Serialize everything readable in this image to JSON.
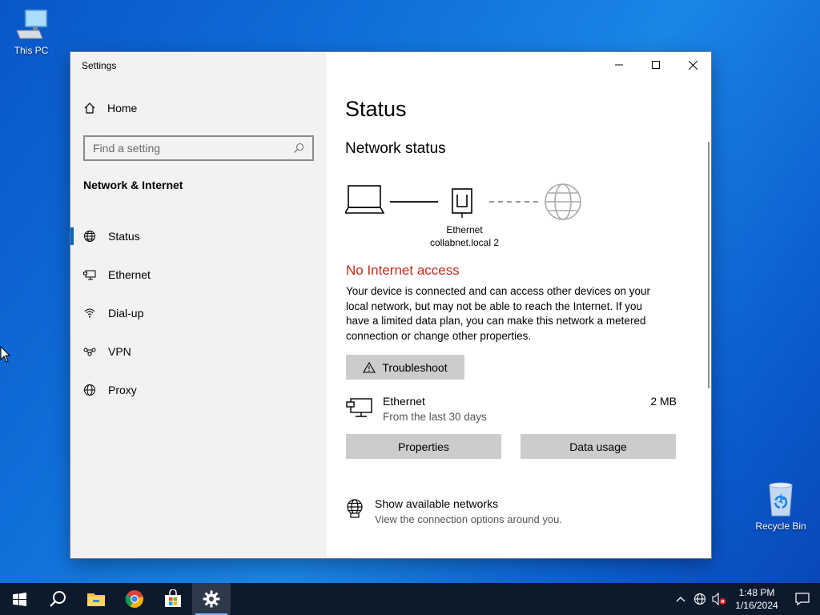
{
  "desktop": {
    "this_pc_label": "This PC",
    "recycle_bin_label": "Recycle Bin"
  },
  "window": {
    "title": "Settings",
    "caption_buttons": [
      "minimize",
      "maximize",
      "close"
    ]
  },
  "sidebar": {
    "home_label": "Home",
    "search_placeholder": "Find a setting",
    "section_heading": "Network & Internet",
    "items": [
      {
        "label": "Status",
        "icon": "status-icon",
        "active": true
      },
      {
        "label": "Ethernet",
        "icon": "ethernet-icon",
        "active": false
      },
      {
        "label": "Dial-up",
        "icon": "dialup-icon",
        "active": false
      },
      {
        "label": "VPN",
        "icon": "vpn-icon",
        "active": false
      },
      {
        "label": "Proxy",
        "icon": "globe-icon",
        "active": false
      }
    ]
  },
  "main": {
    "page_title": "Status",
    "section_title": "Network status",
    "diagram": {
      "adapter_label": "Ethernet",
      "network_name": "collabnet.local 2"
    },
    "status_heading": "No Internet access",
    "status_description": "Your device is connected and can access other devices on your local network, but may not be able to reach the Internet. If you have a limited data plan, you can make this network a metered connection or change other properties.",
    "troubleshoot_label": "Troubleshoot",
    "connection": {
      "name": "Ethernet",
      "period": "From the last 30 days",
      "usage": "2 MB"
    },
    "properties_label": "Properties",
    "data_usage_label": "Data usage",
    "show_networks": {
      "title": "Show available networks",
      "subtitle": "View the connection options around you."
    }
  },
  "taskbar": {
    "apps": [
      "start",
      "search",
      "file-explorer",
      "chrome",
      "store",
      "settings"
    ],
    "time": "1:48 PM",
    "date": "1/16/2024"
  },
  "colors": {
    "accent": "#0067c0",
    "error": "#c42b1c",
    "taskbar": "#0c1a2c"
  }
}
